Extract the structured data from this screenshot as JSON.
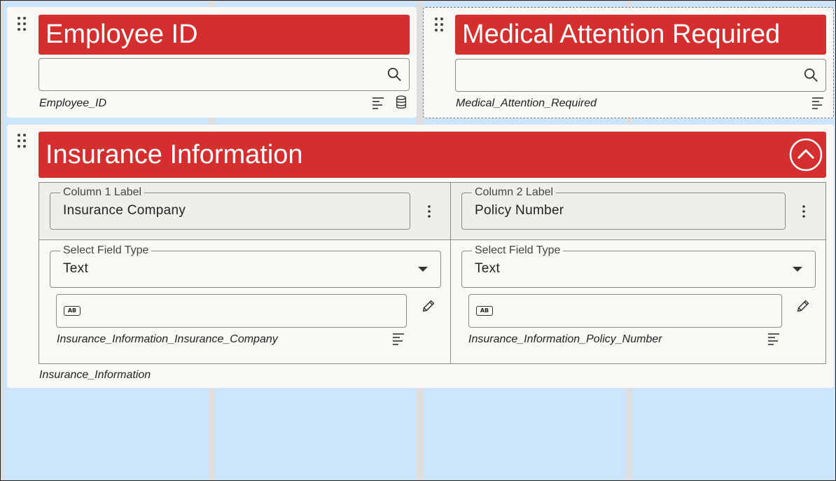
{
  "fields": {
    "employee_id": {
      "title": "Employee ID",
      "variable": "Employee_ID",
      "search_value": ""
    },
    "medical_attention": {
      "title": "Medical Attention Required",
      "variable": "Medical_Attention_Required",
      "search_value": ""
    },
    "insurance": {
      "title": "Insurance Information",
      "variable": "Insurance_Information",
      "columns": [
        {
          "label_legend": "Column 1 Label",
          "label_value": "Insurance Company",
          "type_legend": "Select Field Type",
          "type_value": "Text",
          "input_badge": "AB",
          "variable": "Insurance_Information_Insurance_Company"
        },
        {
          "label_legend": "Column 2 Label",
          "label_value": "Policy Number",
          "type_legend": "Select Field Type",
          "type_value": "Text",
          "input_badge": "AB",
          "variable": "Insurance_Information_Policy_Number"
        }
      ]
    }
  },
  "colors": {
    "header_red": "#d32f2f",
    "grid_blue": "#cce5fd",
    "card_bg": "#f9f8f5"
  }
}
